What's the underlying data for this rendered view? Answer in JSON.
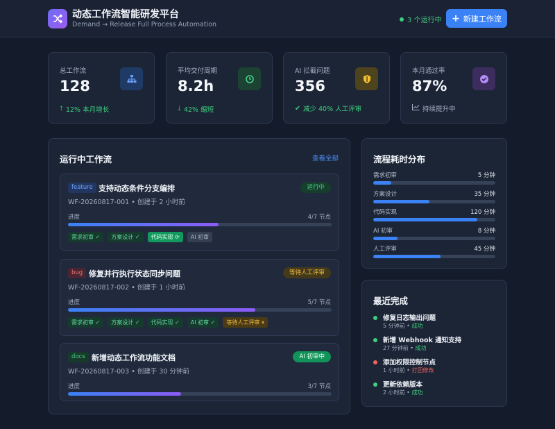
{
  "header": {
    "title": "动态工作流智能研发平台",
    "subtitle": "Demand → Release Full Process Automation",
    "running": "3 个运行中",
    "new_button": "新建工作流"
  },
  "stats": [
    {
      "label": "总工作流",
      "value": "128",
      "change": "12% 本月增长",
      "trend": "up",
      "icon": "sitemap-icon",
      "color": "#2f6ff0"
    },
    {
      "label": "平均交付周期",
      "value": "8.2h",
      "change": "42% 缩短",
      "trend": "down",
      "icon": "clock-icon",
      "color": "#35c47c"
    },
    {
      "label": "AI 拦截问题",
      "value": "356",
      "change": "减少 40% 人工评审",
      "trend": "check",
      "icon": "shield-icon",
      "color": "#f2b632"
    },
    {
      "label": "本月通过率",
      "value": "87%",
      "change": "持续提升中",
      "trend": "chart",
      "icon": "check-circle-icon",
      "color": "#a878f5"
    }
  ],
  "running": {
    "title": "运行中工作流",
    "view_all": "查看全部",
    "progress_label": "进度",
    "items": [
      {
        "type": "feature",
        "name": "支持动态条件分支编排",
        "meta": "WF-20260817-001 • 创建于 2 小时前",
        "state": "运行中",
        "progress_text": "4/7 节点",
        "progress": 0.57,
        "stages": [
          {
            "label": "需求初审 ✓",
            "status": "done"
          },
          {
            "label": "方案设计 ✓",
            "status": "done"
          },
          {
            "label": "代码实现 ⟳",
            "status": "active"
          },
          {
            "label": "AI 初审",
            "status": "pending"
          }
        ]
      },
      {
        "type": "bug",
        "name": "修复并行执行状态同步问题",
        "meta": "WF-20260817-002 • 创建于 1 小时前",
        "state": "等待人工评审",
        "progress_text": "5/7 节点",
        "progress": 0.71,
        "stages": [
          {
            "label": "需求初审 ✓",
            "status": "done"
          },
          {
            "label": "方案设计 ✓",
            "status": "done"
          },
          {
            "label": "代码实现 ✓",
            "status": "done"
          },
          {
            "label": "AI 初审 ✓",
            "status": "done"
          },
          {
            "label": "等待人工评审 ⏸",
            "status": "wait"
          }
        ]
      },
      {
        "type": "docs",
        "name": "新增动态工作流功能文档",
        "meta": "WF-20260817-003 • 创建于 30 分钟前",
        "state": "AI 初审中",
        "progress_text": "3/7 节点",
        "progress": 0.43,
        "stages": []
      }
    ]
  },
  "distribution": {
    "title": "流程耗时分布",
    "rows": [
      {
        "name": "需求初审",
        "value": "5 分钟",
        "ratio": 0.15
      },
      {
        "name": "方案设计",
        "value": "35 分钟",
        "ratio": 0.46
      },
      {
        "name": "代码实现",
        "value": "120 分钟",
        "ratio": 0.85
      },
      {
        "name": "AI 初审",
        "value": "8 分钟",
        "ratio": 0.2
      },
      {
        "name": "人工评审",
        "value": "45 分钟",
        "ratio": 0.55
      }
    ]
  },
  "recent": {
    "title": "最近完成",
    "items": [
      {
        "title": "修复日志输出问题",
        "time": "5 分钟前 • ",
        "result": "成功",
        "ok": true
      },
      {
        "title": "新增 Webhook 通知支持",
        "time": "27 分钟前 • ",
        "result": "成功",
        "ok": true
      },
      {
        "title": "添加权限控制节点",
        "time": "1 小时前 • ",
        "result": "打回修改",
        "ok": false
      },
      {
        "title": "更新依赖版本",
        "time": "2 小时前 • ",
        "result": "成功",
        "ok": true
      }
    ]
  },
  "colors": {
    "accent": "#3b82f6",
    "success": "#3ecf7f",
    "warning": "#f0be41",
    "danger": "#f06262",
    "feature_tag": "#2f6ff0",
    "bug_tag": "#e25a5a",
    "docs_tag": "#35c47c"
  }
}
